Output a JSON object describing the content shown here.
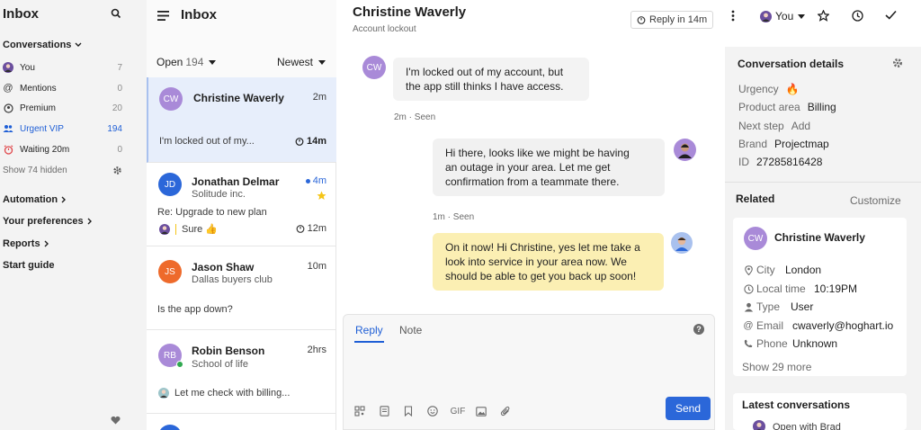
{
  "sidebar": {
    "title": "Inbox",
    "conversations_label": "Conversations",
    "items": [
      {
        "label": "You",
        "count": "7"
      },
      {
        "label": "Mentions",
        "count": "0"
      },
      {
        "label": "Premium",
        "count": "20"
      },
      {
        "label": "Urgent VIP",
        "count": "194"
      },
      {
        "label": "Waiting 20m",
        "count": "0"
      }
    ],
    "show_hidden": "Show 74 hidden",
    "sections": [
      "Automation",
      "Your preferences",
      "Reports",
      "Start guide"
    ],
    "colors": {
      "active": "#1f5fd6"
    }
  },
  "list": {
    "title": "Inbox",
    "filter_state": "Open",
    "filter_count": "194",
    "sort": "Newest",
    "conversations": [
      {
        "initials": "CW",
        "name": "Christine Waverly",
        "time": "2m",
        "subtitle": "",
        "preview": "I'm locked out of my...",
        "timer": "14m",
        "avatar_color": "#a98ad8"
      },
      {
        "initials": "JD",
        "name": "Jonathan Delmar",
        "time": "4m",
        "subtitle": "Solitude inc.",
        "preview": "Re: Upgrade to new plan",
        "reply": "Sure 👍",
        "timer": "12m",
        "avatar_color": "#2b67d9"
      },
      {
        "initials": "JS",
        "name": "Jason Shaw",
        "time": "10m",
        "subtitle": "Dallas buyers club",
        "preview": "Is the app down?",
        "avatar_color": "#ee6a2b"
      },
      {
        "initials": "RB",
        "name": "Robin Benson",
        "time": "2hrs",
        "subtitle": "School of life",
        "preview": "Let me check with billing...",
        "avatar_color": "#a98ad8"
      }
    ]
  },
  "main": {
    "title": "Christine Waverly",
    "subtitle": "Account lockout",
    "snooze": "Reply in 14m",
    "assignee": "You",
    "messages": [
      {
        "type": "in",
        "lines": [
          "I'm locked out of my account, but",
          "the app still thinks I have access."
        ],
        "meta": "2m · Seen"
      },
      {
        "type": "out",
        "lines": [
          "Hi there, looks like we might be having",
          "an outage in your area. Let me get",
          "confirmation from a teammate there."
        ],
        "meta": "1m · Seen"
      },
      {
        "type": "note",
        "lines": [
          "On it now! Hi Christine, yes let me take a",
          "look into service in your area now. We",
          "should be able to get you back up soon!"
        ]
      }
    ],
    "composer": {
      "tab_reply": "Reply",
      "tab_note": "Note",
      "send": "Send",
      "gif": "GIF"
    }
  },
  "details": {
    "title": "Conversation details",
    "rows": [
      {
        "key": "Urgency",
        "value": "🔥"
      },
      {
        "key": "Product area",
        "value": "Billing"
      },
      {
        "key": "Next step",
        "value": "Add"
      },
      {
        "key": "Brand",
        "value": "Projectmap"
      },
      {
        "key": "ID",
        "value": "27285816428"
      }
    ],
    "related_title": "Related",
    "customize": "Customize",
    "contact": {
      "initials": "CW",
      "name": "Christine Waverly",
      "rows": [
        {
          "key": "City",
          "value": "London"
        },
        {
          "key": "Local time",
          "value": "10:19PM"
        },
        {
          "key": "Type",
          "value": "User"
        },
        {
          "key": "Email",
          "value": "cwaverly@hoghart.io"
        },
        {
          "key": "Phone",
          "value": "Unknown"
        }
      ],
      "show_more": "Show 29 more"
    },
    "latest_title": "Latest conversations",
    "latest_item": "Open with Brad"
  }
}
